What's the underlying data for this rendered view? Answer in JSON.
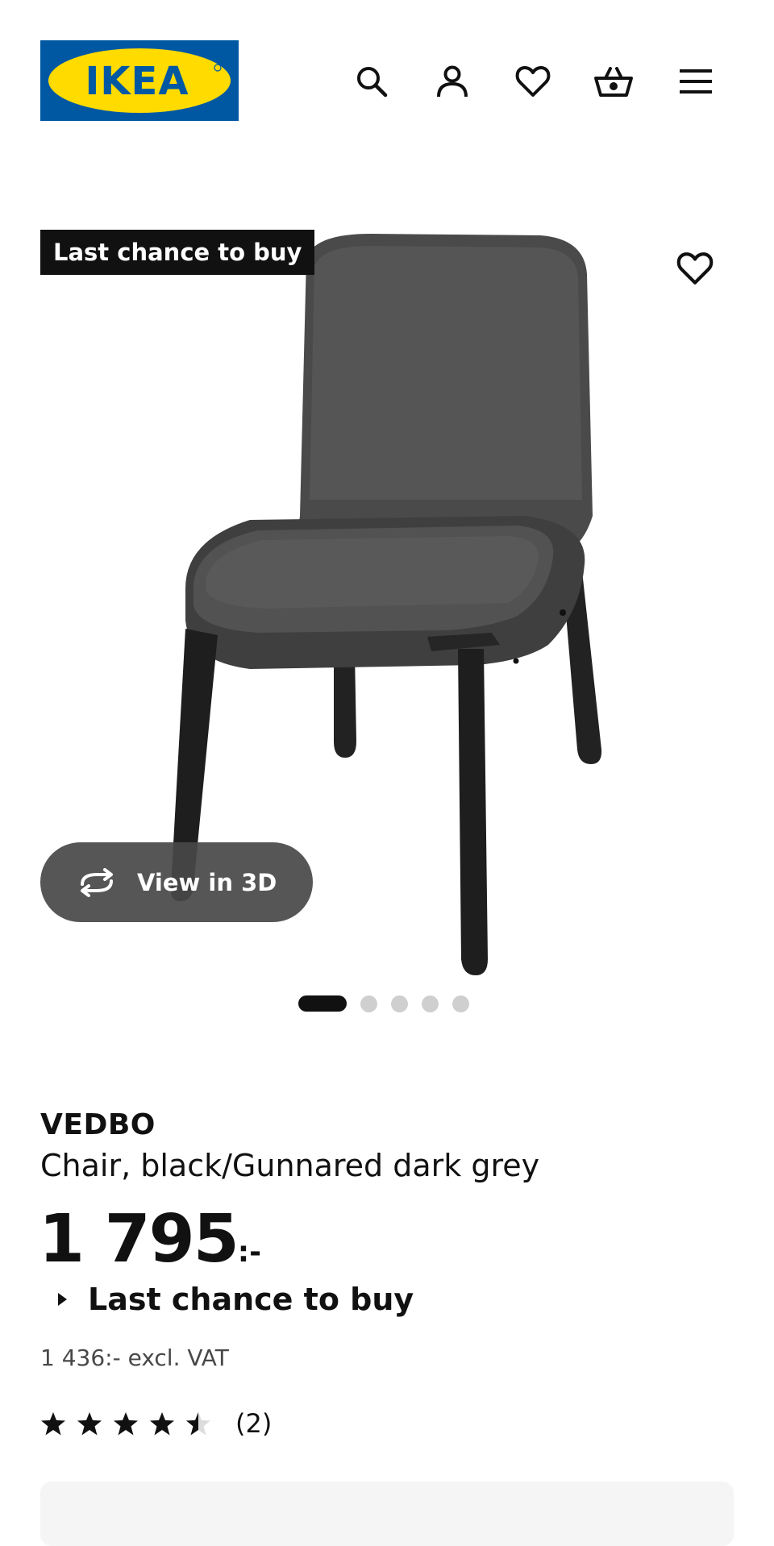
{
  "header": {
    "logo_text": "IKEA",
    "icons": [
      "search-icon",
      "user-icon",
      "heart-icon",
      "basket-icon",
      "menu-icon"
    ]
  },
  "media": {
    "badge": "Last chance to buy",
    "view_3d_label": "View in 3D",
    "image_count": 5,
    "active_image_index": 0
  },
  "product": {
    "name": "VEDBO",
    "description": "Chair, black/Gunnared dark grey",
    "price_main": "1 795",
    "price_suffix": ":-",
    "availability": "Last chance to buy",
    "price_excl_vat": "1 436:- excl. VAT",
    "rating_value": 4.5,
    "rating_max": 5,
    "review_count": "(2)"
  },
  "colors": {
    "ikea_blue": "#0058A3",
    "ikea_yellow": "#FFDB00",
    "text": "#111111",
    "muted": "#484848"
  }
}
